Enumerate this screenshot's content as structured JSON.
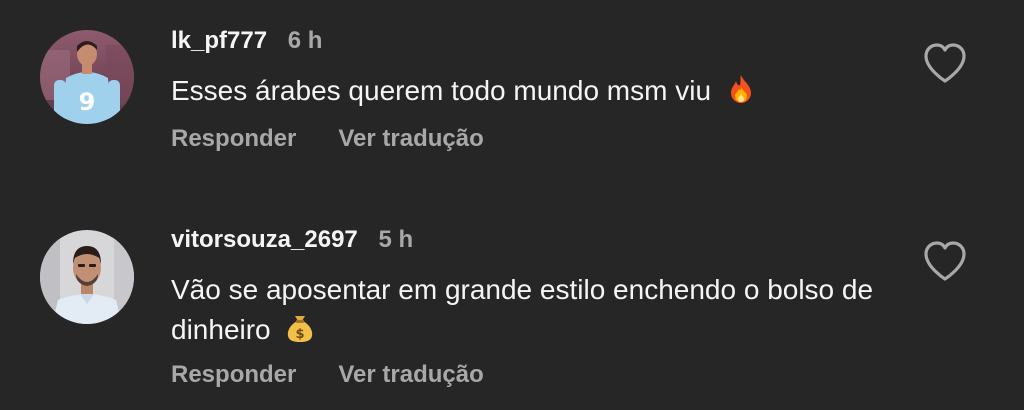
{
  "comments": [
    {
      "username": "lk_pf777",
      "time": "6 h",
      "text": "Esses árabes querem todo mundo msm viu",
      "emoji": "fire-emoji",
      "reply_label": "Responder",
      "translate_label": "Ver tradução",
      "avatar": "profile-photo-player-9"
    },
    {
      "username": "vitorsouza_2697",
      "time": "5 h",
      "text": "Vão se aposentar em grande estilo enchendo o bolso de dinheiro",
      "emoji": "money-bag-emoji",
      "reply_label": "Responder",
      "translate_label": "Ver tradução",
      "avatar": "profile-photo-man"
    }
  ],
  "icons": {
    "like": "heart-outline-icon"
  },
  "colors": {
    "background": "#262626",
    "primary_text": "#f5f5f5",
    "secondary_text": "#a8a8a8"
  }
}
